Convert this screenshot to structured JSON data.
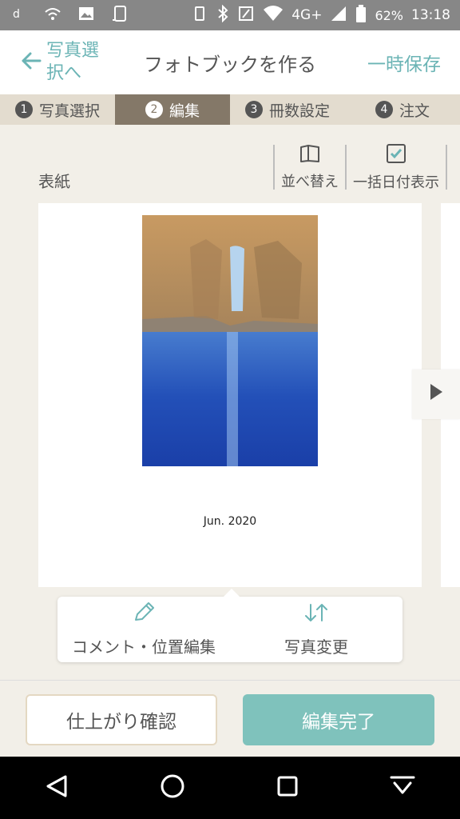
{
  "status_bar": {
    "battery_percent": "62%",
    "time": "13:18",
    "network": "4G+"
  },
  "header": {
    "back_label": "写真選択へ",
    "title": "フォトブックを作る",
    "save_label": "一時保存"
  },
  "steps": [
    {
      "number": "1",
      "label": "写真選択",
      "active": false
    },
    {
      "number": "2",
      "label": "編集",
      "active": true
    },
    {
      "number": "3",
      "label": "冊数設定",
      "active": false
    },
    {
      "number": "4",
      "label": "注文",
      "active": false
    }
  ],
  "editor": {
    "cover_label": "表紙",
    "toolbar": {
      "reorder_label": "並べ替え",
      "date_display_label": "一括日付表示"
    },
    "cover_date": "Jun. 2020"
  },
  "popup": {
    "comment_label": "コメント・位置編集",
    "photo_change_label": "写真変更"
  },
  "footer": {
    "preview_label": "仕上がり確認",
    "done_label": "編集完了"
  },
  "colors": {
    "accent": "#6bb4b5",
    "done_button": "#7fc2bc",
    "active_step": "#847868",
    "background": "#f2efe8"
  }
}
